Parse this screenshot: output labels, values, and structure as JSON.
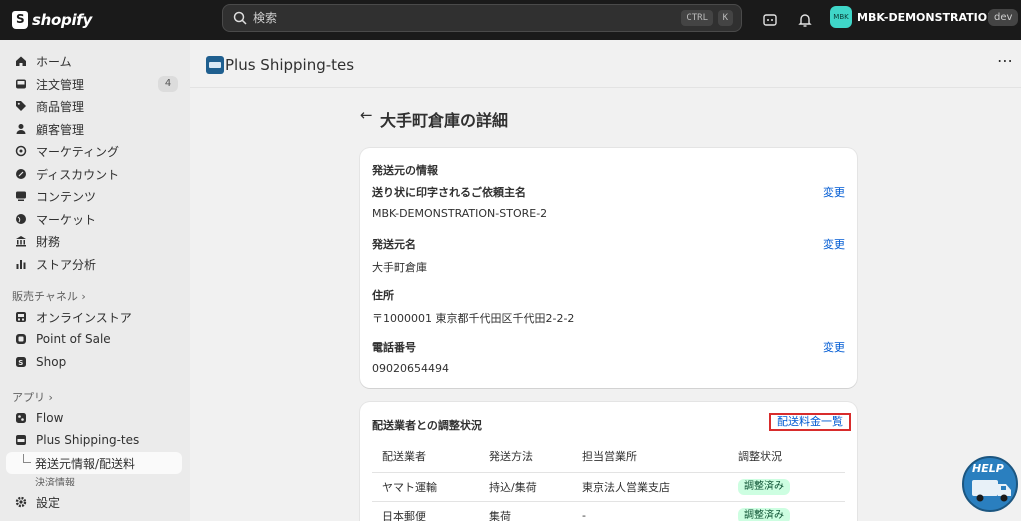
{
  "topbar": {
    "logo_text": "shopify",
    "search_placeholder": "検索",
    "kbd_ctrl": "CTRL",
    "kbd_k": "K",
    "store_avatar": "MBK",
    "store_name": "MBK-DEMONSTRATION-...",
    "env_badge": "dev"
  },
  "sidebar": {
    "items": [
      {
        "label": "ホーム",
        "icon": "home-icon"
      },
      {
        "label": "注文管理",
        "icon": "inbox-icon",
        "count": "4"
      },
      {
        "label": "商品管理",
        "icon": "tag-icon"
      },
      {
        "label": "顧客管理",
        "icon": "person-icon"
      },
      {
        "label": "マーケティング",
        "icon": "target-icon"
      },
      {
        "label": "ディスカウント",
        "icon": "discount-icon"
      },
      {
        "label": "コンテンツ",
        "icon": "content-icon"
      },
      {
        "label": "マーケット",
        "icon": "globe-icon"
      },
      {
        "label": "財務",
        "icon": "bank-icon"
      },
      {
        "label": "ストア分析",
        "icon": "chart-icon"
      }
    ],
    "sales_channels_label": "販売チャネル",
    "channels": [
      {
        "label": "オンラインストア",
        "icon": "store-icon"
      },
      {
        "label": "Point of Sale",
        "icon": "pos-icon"
      },
      {
        "label": "Shop",
        "icon": "shop-icon"
      }
    ],
    "apps_label": "アプリ",
    "apps": [
      {
        "label": "Flow",
        "icon": "flow-icon"
      },
      {
        "label": "Plus Shipping-tes",
        "icon": "app-icon"
      }
    ],
    "app_sub_active": "発送元情報/配送料",
    "app_sub_next": "決済情報",
    "settings_label": "設定"
  },
  "app": {
    "title": "Plus Shipping-tes",
    "more": "⋯"
  },
  "page": {
    "back": "←",
    "title": "大手町倉庫の詳細"
  },
  "origin_card": {
    "heading": "発送元の情報",
    "sender_label": "送り状に印字されるご依頼主名",
    "sender_value": "MBK-DEMONSTRATION-STORE-2",
    "origin_name_label": "発送元名",
    "origin_name_value": "大手町倉庫",
    "address_label": "住所",
    "address_value": "〒1000001 東京都千代田区千代田2-2-2",
    "phone_label": "電話番号",
    "phone_value": "09020654494",
    "change_link": "変更"
  },
  "carrier_card": {
    "heading": "配送業者との調整状況",
    "rates_link": "配送料金一覧",
    "columns": [
      "配送業者",
      "発送方法",
      "担当営業所",
      "調整状況"
    ],
    "rows": [
      {
        "carrier": "ヤマト運輸",
        "method": "持込/集荷",
        "office": "東京法人営業支店",
        "status": "調整済み"
      },
      {
        "carrier": "日本郵便",
        "method": "集荷",
        "office": "-",
        "status": "調整済み"
      }
    ]
  },
  "help": {
    "label": "HELP"
  },
  "colors": {
    "topbar": "#1a1a1a",
    "link": "#005bd3",
    "highlight_border": "#d82c2c",
    "status_bg": "#cdfee1",
    "status_text": "#0c5132"
  }
}
